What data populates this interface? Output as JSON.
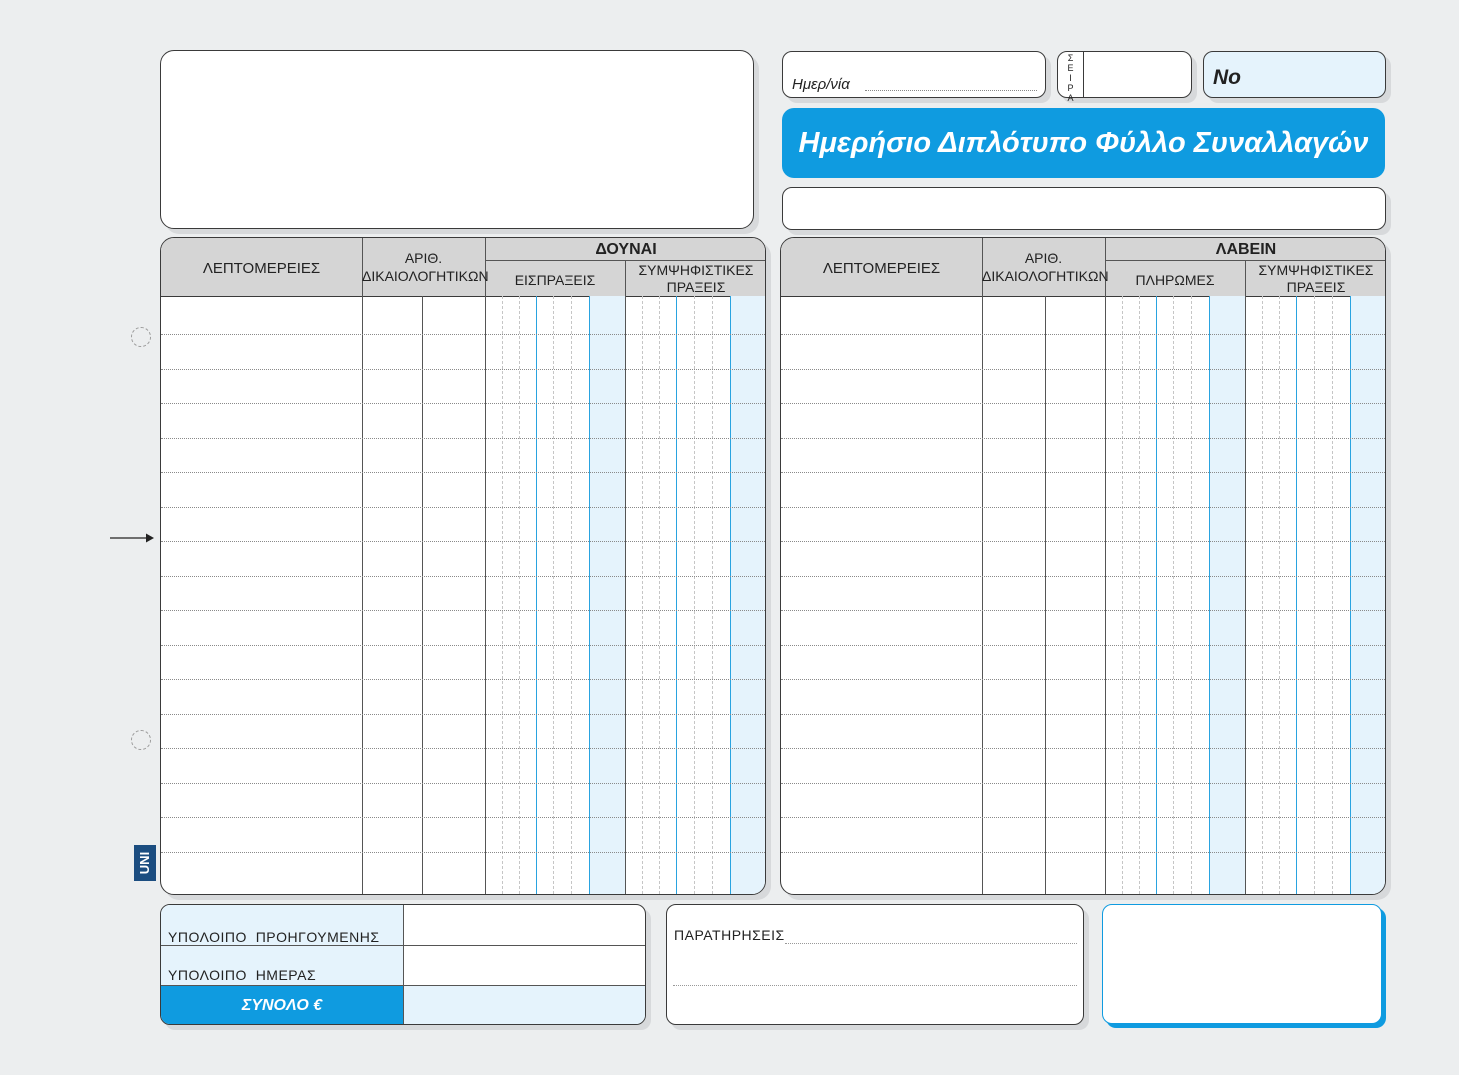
{
  "header": {
    "date_label": "Ημερ/νία",
    "series_label": "ΣΕΙΡΑ",
    "number_label": "No",
    "title": "Ημερήσιο Διπλότυπο Φύλλο Συναλλαγών"
  },
  "left_table": {
    "details": "ΛΕΠΤΟΜΕΡΕΙΕΣ",
    "doc_no_line1": "ΑΡΙΘ.",
    "doc_no_line2": "ΔΙΚΑΙΟΛΟΓΗΤΙΚΩΝ",
    "group": "ΔΟΥΝΑΙ",
    "col1": "ΕΙΣΠΡΑΞΕΙΣ",
    "col2_line1": "ΣΥΜΨΗΦΙΣΤΙΚΕΣ",
    "col2_line2": "ΠΡΑΞΕΙΣ"
  },
  "right_table": {
    "details": "ΛΕΠΤΟΜΕΡΕΙΕΣ",
    "doc_no_line1": "ΑΡΙΘ.",
    "doc_no_line2": "ΔΙΚΑΙΟΛΟΓΗΤΙΚΩΝ",
    "group": "ΛΑΒΕΙΝ",
    "col1": "ΠΛΗΡΩΜΕΣ",
    "col2_line1": "ΣΥΜΨΗΦΙΣΤΙΚΕΣ",
    "col2_line2": "ΠΡΑΞΕΙΣ"
  },
  "footer": {
    "prev_balance": "ΥΠΟΛΟΙΠΟ  ΠΡΟΗΓΟΥΜΕΝΗΣ",
    "day_balance": "ΥΠΟΛΟΙΠΟ  ΗΜΕΡΑΣ",
    "total": "ΣΥΝΟΛΟ €",
    "remarks": "ΠΑΡΑΤΗΡΗΣΕΙΣ"
  },
  "brand": "UNI",
  "colors": {
    "accent": "#0f9be0",
    "shade": "#e5f3fc",
    "header_gray": "#d5d5d5"
  }
}
